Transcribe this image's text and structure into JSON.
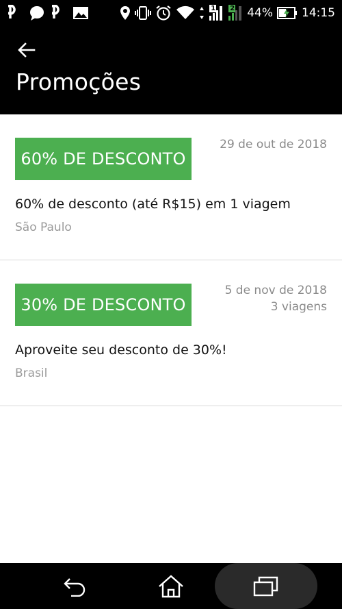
{
  "status_bar": {
    "battery_percent": "44%",
    "time": "14:15",
    "sim1_label": "1",
    "sim2_label": "2",
    "left_icons": [
      "b-app-icon",
      "chat-bubble-icon",
      "b-app-icon",
      "image-icon"
    ],
    "right_icons": [
      "location-pin-icon",
      "vibrate-icon",
      "alarm-icon",
      "wifi-icon",
      "signal-icon",
      "battery-charging-icon"
    ]
  },
  "header": {
    "title": "Promoções",
    "back_icon": "arrow-left-icon"
  },
  "promotions": [
    {
      "badge": "60% DE DESCONTO",
      "date": "29 de out de 2018",
      "trips": "",
      "title": "60% de desconto (até R$15) em 1 viagem",
      "location": "São Paulo"
    },
    {
      "badge": "30% DE DESCONTO",
      "date": "5 de nov de 2018",
      "trips": "3 viagens",
      "title": "Aproveite seu desconto de 30%!",
      "location": "Brasil"
    }
  ],
  "nav_bar": {
    "buttons": [
      "back-nav-icon",
      "home-icon",
      "recents-icon"
    ]
  },
  "colors": {
    "badge_green": "#4caf50",
    "header_bg": "#000000",
    "meta_gray": "#8a8a8a"
  }
}
